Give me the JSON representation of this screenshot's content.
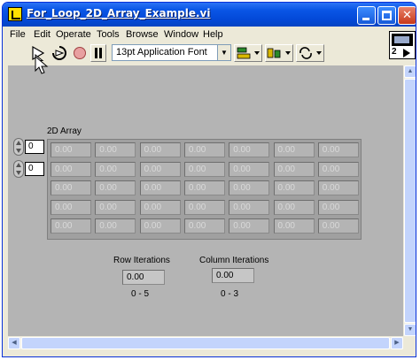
{
  "window": {
    "title": "For_Loop_2D_Array_Example.vi",
    "minimize_glyph": "",
    "close_glyph": "✕"
  },
  "menu": [
    "File",
    "Edit",
    "Operate",
    "Tools",
    "Browse",
    "Window",
    "Help"
  ],
  "toolbar": {
    "font": "13pt Application Font",
    "icons": [
      "run-arrow-icon",
      "run-continuously-icon",
      "abort-icon",
      "pause-icon",
      "align-objects-icon",
      "distribute-objects-icon",
      "reorder-icon"
    ]
  },
  "vi_icon": {
    "number": "2"
  },
  "panel": {
    "array": {
      "label": "2D Array",
      "row_index": "0",
      "col_index": "0",
      "rows": [
        [
          "0.00",
          "0.00",
          "0.00",
          "0.00",
          "0.00",
          "0.00",
          "0.00"
        ],
        [
          "0.00",
          "0.00",
          "0.00",
          "0.00",
          "0.00",
          "0.00",
          "0.00"
        ],
        [
          "0.00",
          "0.00",
          "0.00",
          "0.00",
          "0.00",
          "0.00",
          "0.00"
        ],
        [
          "0.00",
          "0.00",
          "0.00",
          "0.00",
          "0.00",
          "0.00",
          "0.00"
        ],
        [
          "0.00",
          "0.00",
          "0.00",
          "0.00",
          "0.00",
          "0.00",
          "0.00"
        ]
      ]
    },
    "row_iterations": {
      "label": "Row Iterations",
      "value": "0.00",
      "range": "0 - 5"
    },
    "column_iterations": {
      "label": "Column Iterations",
      "value": "0.00",
      "range": "0 - 3"
    }
  },
  "colors": {
    "titlebar": "#0a56e6",
    "panel": "#b4b4b4",
    "window_chrome": "#ece9d8"
  }
}
